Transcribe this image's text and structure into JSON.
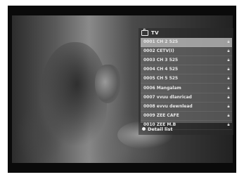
{
  "panel": {
    "title": "TV",
    "icon": "tv-icon",
    "channels": [
      {
        "label": "0001 CH 2 525",
        "icon": "lock-icon"
      },
      {
        "label": "0002 CETV(I)",
        "icon": "lock-icon"
      },
      {
        "label": "0003 CH 3 525",
        "icon": "lock-icon"
      },
      {
        "label": "0004 CH 4 525",
        "icon": "lock-icon"
      },
      {
        "label": "0005 CH 5 525",
        "icon": "lock-icon"
      },
      {
        "label": "0006 Mangalam",
        "icon": "lock-icon"
      },
      {
        "label": "0007 vvuu dlanricad",
        "icon": "lock-icon"
      },
      {
        "label": "0008 evvu dewnlead",
        "icon": "lock-icon"
      },
      {
        "label": "0009 ZEE CAFE",
        "icon": "lock-icon"
      },
      {
        "label": "0010 ZEE M.B",
        "icon": "lock-icon"
      }
    ],
    "footer": {
      "label": "Detail list",
      "key_icon": "circle-key-icon"
    }
  }
}
